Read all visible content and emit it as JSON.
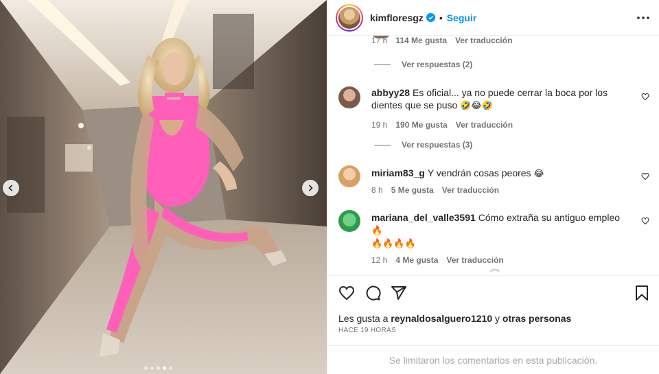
{
  "post": {
    "username": "kimfloresgz",
    "follow_label": "Seguir",
    "separator": "•",
    "carousel_total": 5,
    "carousel_active_index": 3
  },
  "comments_top": {
    "meta_time": "17 h",
    "meta_likes": "114 Me gusta",
    "meta_translate": "Ver traducción",
    "replies": "Ver respuestas (2)"
  },
  "comments": [
    {
      "user": "abbyy28",
      "text": "Es oficial... ya no puede cerrar la boca por los dientes que se puso",
      "emoji": "🤣😂🤣",
      "time": "19 h",
      "likes": "190 Me gusta",
      "translate": "Ver traducción",
      "replies": "Ver respuestas (3)",
      "avatar_color": "#7b5a4a"
    },
    {
      "user": "miriam83_g",
      "text": "Y vendrán cosas peores",
      "emoji": "😂",
      "time": "8 h",
      "likes": "5 Me gusta",
      "translate": "Ver traducción",
      "avatar_color": "#d9a066"
    },
    {
      "user": "mariana_del_valle3591",
      "text": "Cómo extraña su antiguo empleo",
      "emoji": "🔥",
      "emoji_line2": "🔥🔥🔥🔥",
      "time": "12 h",
      "likes": "4 Me gusta",
      "translate": "Ver traducción",
      "avatar_color": "#2e9b4a"
    }
  ],
  "actions": {
    "liked_prefix": "Les gusta a",
    "liked_user": "reynaldosalguero1210",
    "liked_suffix": "y",
    "liked_others": "otras personas",
    "time_ago": "HACE 19 HORAS"
  },
  "footer": {
    "limited": "Se limitaron los comentarios en esta publicación."
  },
  "icons": {
    "verified": "verified-badge-icon",
    "more": "more-options-icon",
    "like": "heart-icon",
    "comment": "comment-icon",
    "share": "share-icon",
    "save": "bookmark-icon"
  },
  "colors": {
    "link_blue": "#0095f6",
    "muted": "#737373",
    "text": "#262626",
    "outfit_pink": "#ff5fb8"
  }
}
